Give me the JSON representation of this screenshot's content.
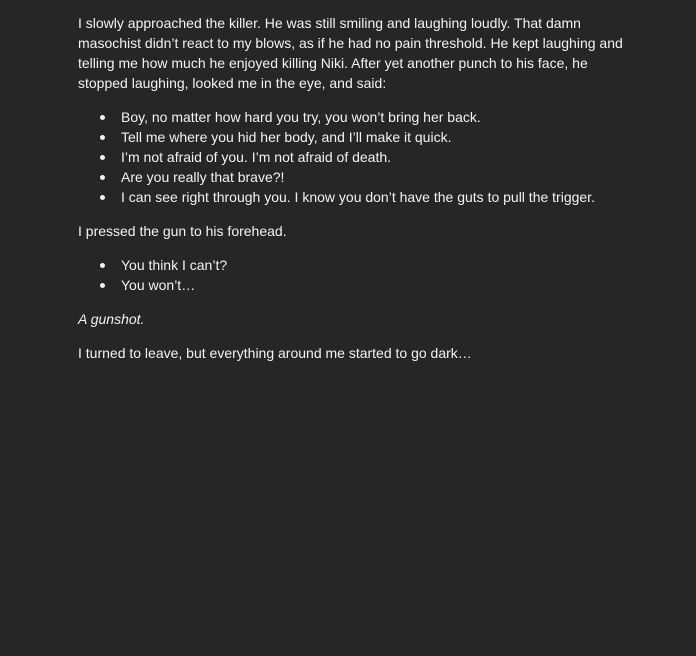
{
  "doc": {
    "intro": "I slowly approached the killer. He was still smiling and laughing loudly. That damn masochist didn’t react to my blows, as if he had no pain threshold. He kept laughing and telling me how much he enjoyed killing Niki. After yet another punch to his face, he stopped laughing, looked me in the eye, and said:",
    "list1": [
      "Boy, no matter how hard you try, you won’t bring her back.",
      "Tell me where you hid her body, and I’ll make it quick.",
      "I’m not afraid of you. I’m not afraid of death.",
      "Are you really that brave?!",
      "I can see right through you. I know you don’t have the guts to pull the trigger."
    ],
    "mid": "I pressed the gun to his forehead.",
    "list2": [
      "You think I can’t?",
      "You won’t…"
    ],
    "gunshot": "A gunshot.",
    "ending": "I turned to leave, but everything around me started to go dark…"
  }
}
